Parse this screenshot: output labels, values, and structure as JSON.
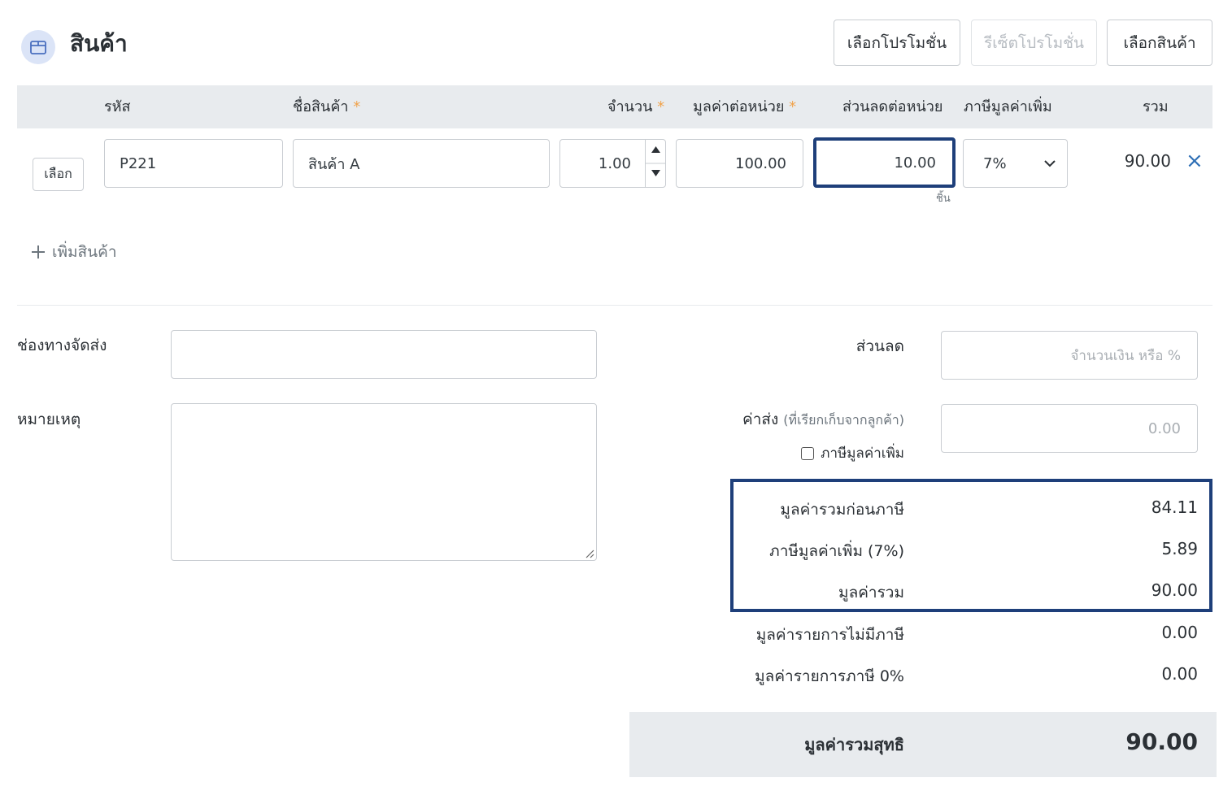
{
  "section": {
    "title": "สินค้า",
    "icon": "box-icon"
  },
  "header_buttons": {
    "select_promo": "เลือกโปรโมชั่น",
    "reset_promo": "รีเซ็ตโปรโมชั่น",
    "select_product": "เลือกสินค้า"
  },
  "table": {
    "headers": {
      "code": "รหัส",
      "name": "ชื่อสินค้า",
      "qty": "จำนวน",
      "unit_price": "มูลค่าต่อหน่วย",
      "discount": "ส่วนลดต่อหน่วย",
      "vat": "ภาษีมูลค่าเพิ่ม",
      "total": "รวม"
    },
    "required_mark": "*",
    "row": {
      "select_label": "เลือก",
      "code": "P221",
      "name": "สินค้า A",
      "qty": "1.00",
      "unit_price": "100.00",
      "discount": "10.00",
      "unit": "ชิ้น",
      "vat": "7%",
      "total": "90.00",
      "remove": "×"
    }
  },
  "add_product": "เพิ่มสินค้า",
  "form": {
    "shipping_channel_label": "ช่องทางจัดส่ง",
    "note_label": "หมายเหตุ",
    "discount_label": "ส่วนลด",
    "discount_placeholder": "จำนวนเงิน หรือ %",
    "shipping_fee_label": "ค่าส่ง",
    "shipping_fee_hint": "(ที่เรียกเก็บจากลูกค้า)",
    "shipping_fee_placeholder": "0.00",
    "shipping_vat_label": "ภาษีมูลค่าเพิ่ม"
  },
  "summary": {
    "before_tax_label": "มูลค่ารวมก่อนภาษี",
    "before_tax": "84.11",
    "vat_label": "ภาษีมูลค่าเพิ่ม (7%)",
    "vat": "5.89",
    "total_label": "มูลค่ารวม",
    "total": "90.00",
    "non_tax_label": "มูลค่ารายการไม่มีภาษี",
    "non_tax": "0.00",
    "zero_tax_label": "มูลค่ารายการภาษี 0%",
    "zero_tax": "0.00",
    "net_label": "มูลค่ารวมสุทธิ",
    "net": "90.00"
  },
  "colors": {
    "highlight": "#1e3f7a",
    "header_bg": "#e8ebee",
    "required": "#f0a24a",
    "remove": "#2e6fb5"
  }
}
